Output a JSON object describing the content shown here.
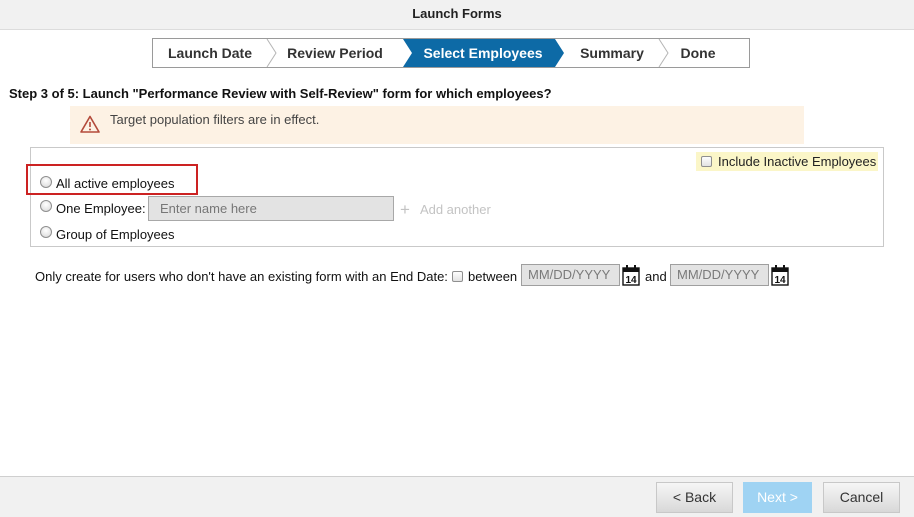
{
  "window": {
    "title": "Launch Forms"
  },
  "wizard": {
    "steps": [
      {
        "label": "Launch Date"
      },
      {
        "label": "Review Period"
      },
      {
        "label": "Select Employees"
      },
      {
        "label": "Summary"
      },
      {
        "label": "Done"
      }
    ],
    "active_step": "Select Employees",
    "active_color": "#0d6aa6"
  },
  "heading": "Step 3 of 5: Launch \"Performance Review with Self-Review\" form for which employees?",
  "notice": {
    "icon": "warning-icon",
    "text": "Target population filters are in effect.",
    "background": "#fdf2e4"
  },
  "options": {
    "include_inactive_label": "Include Inactive Employees",
    "include_inactive_checked": false,
    "all_active_label": "All active employees",
    "one_employee_label": "One Employee:",
    "name_placeholder": "Enter name here",
    "add_another_label": "Add another",
    "group_label": "Group of Employees",
    "selected": null
  },
  "date_filter": {
    "label": "Only create for users who don't have an existing form with an End Date:",
    "between_label": "between",
    "and_label": "and",
    "start_placeholder": "MM/DD/YYYY",
    "end_placeholder": "MM/DD/YYYY",
    "calendar_day": "14",
    "checked": false
  },
  "footer": {
    "back_label": "< Back",
    "next_label": "Next >",
    "cancel_label": "Cancel"
  }
}
